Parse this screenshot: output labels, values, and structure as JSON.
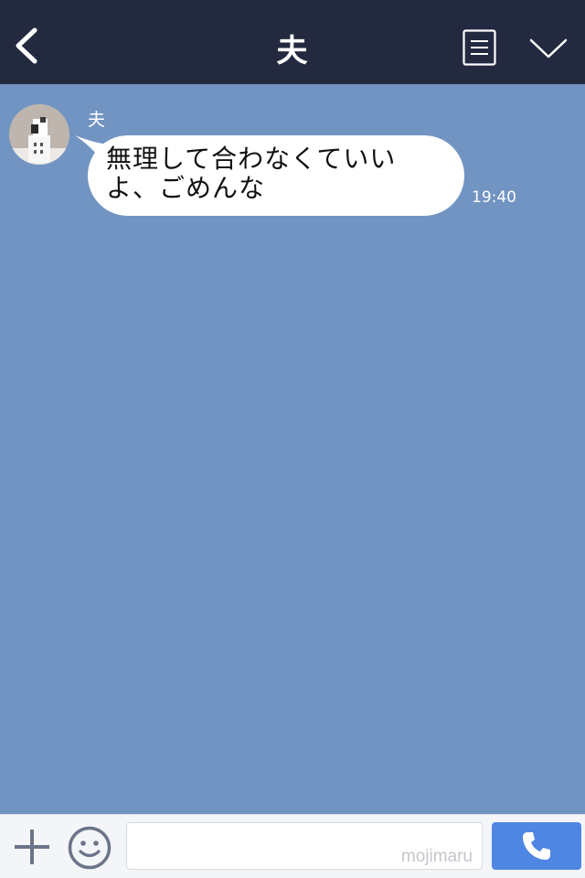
{
  "header": {
    "title": "夫",
    "icons": [
      "back-icon",
      "notes-icon",
      "chevron-down-icon"
    ]
  },
  "conversation": {
    "messages": [
      {
        "sender": "夫",
        "text": "無理して合わなくていいよ、ごめんな",
        "time": "19:40",
        "avatar": "avatar"
      }
    ]
  },
  "footer": {
    "watermark": "mojimaru",
    "icons": [
      "plus-icon",
      "emoji-icon",
      "phone-icon"
    ]
  },
  "colors": {
    "header_bg": "#232a40",
    "chat_bg": "#7194c2",
    "bubble_bg": "#ffffff",
    "call_button": "#4f86e3",
    "footer_bg": "#f4f5f8",
    "footer_icon": "#6b7488"
  }
}
